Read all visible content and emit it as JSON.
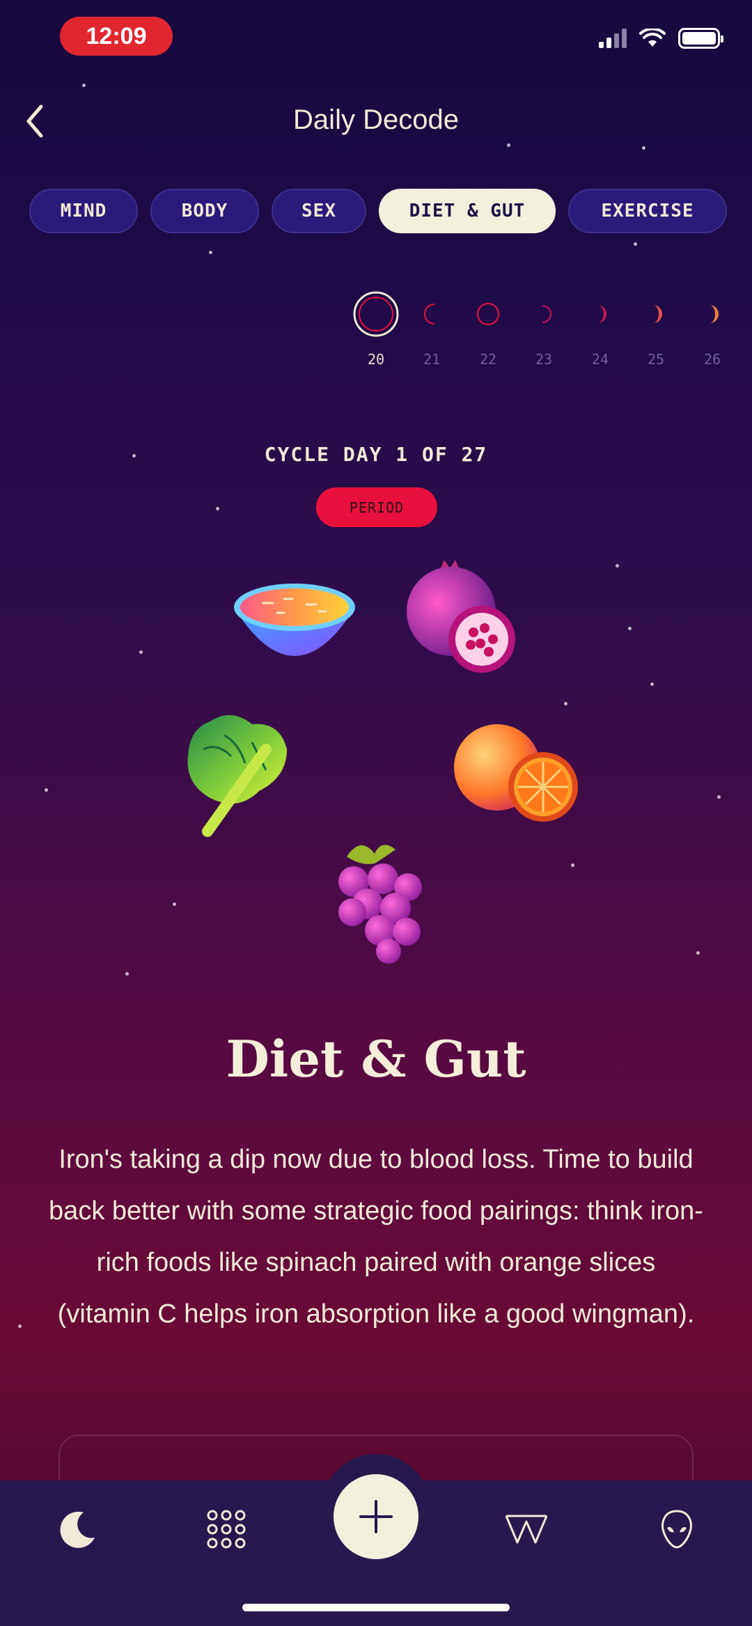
{
  "status_bar": {
    "time": "12:09"
  },
  "header": {
    "title": "Daily Decode"
  },
  "tabs": [
    {
      "label": "MIND",
      "active": false
    },
    {
      "label": "BODY",
      "active": false
    },
    {
      "label": "SEX",
      "active": false
    },
    {
      "label": "DIET & GUT",
      "active": true
    },
    {
      "label": "EXERCISE",
      "active": false
    }
  ],
  "days": [
    {
      "num": "20",
      "selected": true
    },
    {
      "num": "21",
      "selected": false
    },
    {
      "num": "22",
      "selected": false
    },
    {
      "num": "23",
      "selected": false
    },
    {
      "num": "24",
      "selected": false
    },
    {
      "num": "25",
      "selected": false
    },
    {
      "num": "26",
      "selected": false
    }
  ],
  "cycle": {
    "label": "CYCLE DAY 1 OF 27",
    "phase": "PERIOD"
  },
  "section": {
    "title": "Diet & Gut",
    "description": "Iron's taking a dip now due to blood loss. Time to build back better with some strategic food pairings: think iron-rich foods like spinach paired with orange slices (vitamin C helps iron absorption like a good wingman)."
  },
  "icons": {
    "back": "chevron-left-icon",
    "moon_nav": "moon-icon",
    "grid_nav": "dot-grid-icon",
    "add": "plus-icon",
    "w_nav": "w-logo-icon",
    "alien_nav": "alien-icon",
    "foods": [
      "soup-bowl-icon",
      "pomegranate-icon",
      "spinach-icon",
      "orange-icon",
      "grapes-icon"
    ]
  },
  "colors": {
    "accent_period": "#e8103c",
    "tab_bg": "#2a1a7a",
    "tab_active_bg": "#f2f0dc",
    "nav_bg": "#27194f"
  }
}
